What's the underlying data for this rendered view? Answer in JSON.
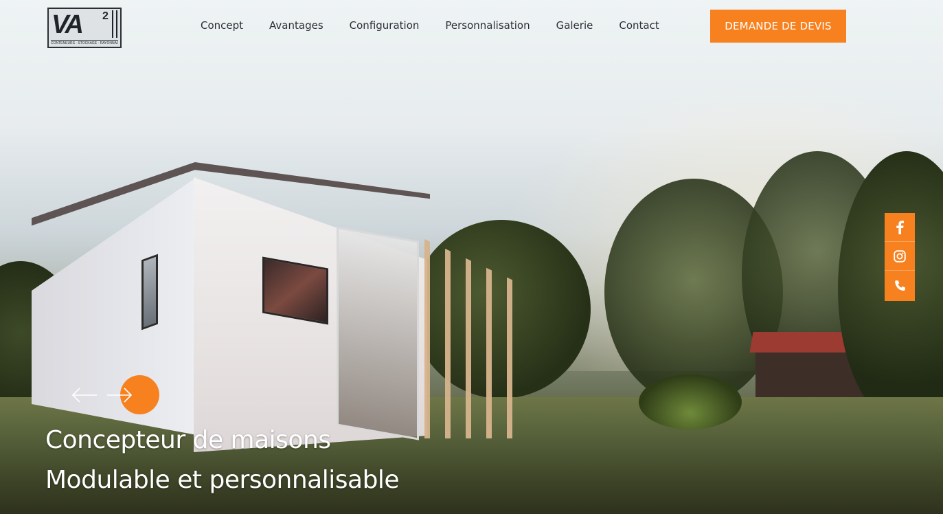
{
  "brand": {
    "logo_mark": "VA",
    "logo_sup": "2",
    "logo_tagline": "CONTENEURS · STOCKAGE · RAYONNAGE"
  },
  "nav": {
    "items": [
      {
        "label": "Concept"
      },
      {
        "label": "Avantages"
      },
      {
        "label": "Configuration"
      },
      {
        "label": "Personnalisation"
      },
      {
        "label": "Galerie"
      },
      {
        "label": "Contact"
      }
    ]
  },
  "cta": {
    "label": "DEMANDE DE DEVIS"
  },
  "social": {
    "items": [
      {
        "icon": "facebook-icon"
      },
      {
        "icon": "instagram-icon"
      },
      {
        "icon": "phone-icon"
      }
    ]
  },
  "hero": {
    "line1": "Concepteur de maisons",
    "line2": "Modulable et personnalisable"
  },
  "colors": {
    "accent": "#f7811f",
    "nav_text": "#2d2f33",
    "hero_text": "#ffffff"
  }
}
